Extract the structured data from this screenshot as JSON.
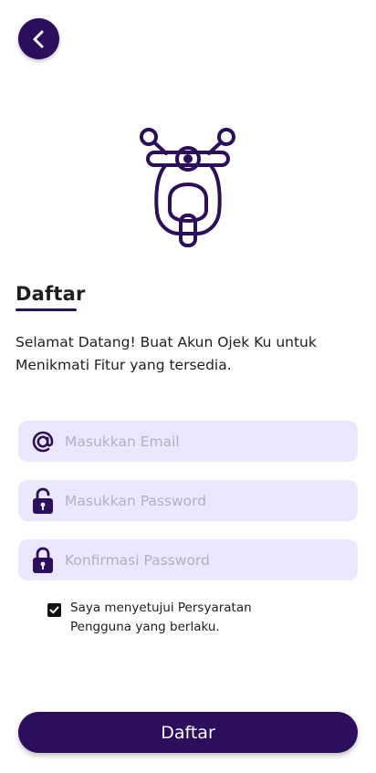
{
  "colors": {
    "primary": "#2b0f5c",
    "field_background": "#ebe8fd",
    "placeholder": "#b2b0c4"
  },
  "header": {
    "back_icon": "chevron-left-icon"
  },
  "hero": {
    "icon": "scooter-icon"
  },
  "page": {
    "title": "Daftar",
    "welcome": "Selamat Datang! Buat Akun Ojek Ku  untuk Menikmati Fitur yang tersedia."
  },
  "form": {
    "email": {
      "placeholder": "Masukkan Email",
      "value": "",
      "icon": "at-sign-icon"
    },
    "password": {
      "placeholder": "Masukkan Password",
      "value": "",
      "icon": "unlock-icon"
    },
    "confirm_password": {
      "placeholder": "Konfirmasi Password",
      "value": "",
      "icon": "lock-icon"
    },
    "terms": {
      "checked": true,
      "label": "Saya menyetujui Persyaratan Pengguna yang berlaku."
    }
  },
  "submit": {
    "label": "Daftar"
  }
}
